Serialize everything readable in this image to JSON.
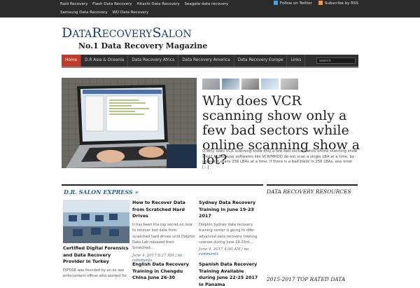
{
  "topbar": {
    "links": [
      "Raid Recovery",
      "Flash Data Recovery",
      "Hitachi Data Recovery",
      "Seagate data recovery",
      "Samsung Data Recovery",
      "WD Data Recovery"
    ],
    "follow_twitter": "Follow on Twitter",
    "subscribe_rss": "Subscribe by RSS"
  },
  "logo": {
    "d": "D",
    "ata": "ATA",
    "r": "R",
    "ecovery": "ECOVERY",
    "s": "S",
    "alon": "ALON",
    "tagline": "No.1 Data Recovery Magazine"
  },
  "nav": {
    "items": [
      "Home",
      "D.R Asia & Oceania",
      "Data Recovery Africa",
      "Data Recovery America",
      "Data Recovery Europe",
      "Links"
    ],
    "search_placeholder": "search"
  },
  "featured": {
    "title": "Why does VCR scanning show only a few bad sectors while online scanning show a lot?",
    "excerpt": "Q:Why does VCR scanning show only a few bad sectors while online scanning show a lot? A: Because softwares like VCR/MHDD do not scan a single LBA at a time, by default it scans 256 LBAs at a time. If there is a bad block in 256 LBAs, one error [...]"
  },
  "express": {
    "heading": "D.R. SALON EXPRESS »",
    "col1": {
      "title": "Certified Digital Forensics and Data Recovery Provider in Turkey",
      "excerpt": "DIPOSE was founded by an ex-law enforcement officer who worked for"
    },
    "col2": [
      {
        "title": "How to Recover Data from Scratched Hard Drives",
        "excerpt": "It has been the top secret on how to recover lost data from scratched hard drives until Dolphin Data Lab released their Scratched...",
        "date": "June 4, 2017 8:27 AM",
        "comments": "no comments"
      },
      {
        "title": "English Data Recovery Training in Chengdu China June 26-30",
        "excerpt": "",
        "date": "",
        "comments": ""
      }
    ],
    "col3": [
      {
        "title": "Sydney Data Recovery Training in June 19-23 2017",
        "excerpt": "Dolphin Sydney data recovery training center is going to offer advanced data recovery training courses during June 19-23rd,...",
        "date": "June 4, 2017 4:50 AM",
        "comments": "no comments"
      },
      {
        "title": "Spanish Data Recovery Training Available during June 22-25 2017 in Panama",
        "excerpt": "",
        "date": "",
        "comments": ""
      }
    ]
  },
  "sidebar": {
    "resources_heading": "DATA RECOVERY RESOURCES",
    "top_heading": "2015-2017 TOP RATED DATA"
  },
  "colors": {
    "topbar_bg": "#2b2b2b",
    "brand_blue": "#21406b",
    "nav_active": "#c0392b",
    "link_blue": "#2a6496"
  }
}
